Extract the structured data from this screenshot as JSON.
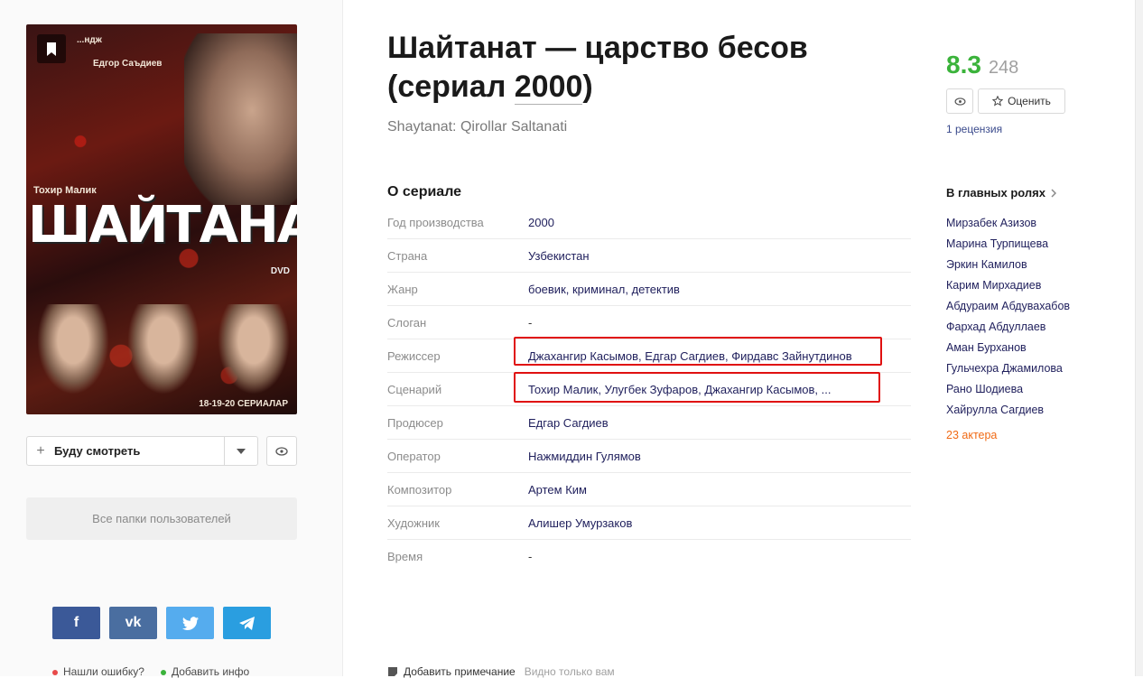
{
  "poster": {
    "top_credit": "...ндж",
    "director_credit": "Едгор Саъдиев",
    "writer_credit": "Тохир Малик",
    "title_text": "ШАЙТАНАТ",
    "dvd_label": "DVD",
    "episodes_credit": "18-19-20 СЕРИАЛАР"
  },
  "watch": {
    "label": "Буду смотреть"
  },
  "folders": {
    "label": "Все папки пользователей"
  },
  "social": [
    {
      "name": "facebook",
      "glyph": "f",
      "color": "#3b5998"
    },
    {
      "name": "vk",
      "glyph": "vk",
      "color": "#4a6ea0"
    },
    {
      "name": "twitter",
      "glyph": "t",
      "color": "#55acee"
    },
    {
      "name": "telegram",
      "glyph": "➤",
      "color": "#2a9ee0"
    }
  ],
  "bottom_links": {
    "error": "Нашли ошибку?",
    "error_color": "#e84a4a",
    "add_info": "Добавить инфо",
    "add_info_color": "#3bb33b"
  },
  "title": {
    "main": "Шайтанат — царство бесов",
    "prefix": "(сериал ",
    "year": "2000",
    "suffix": ")"
  },
  "original_title": "Shaytanat: Qirollar Saltanati",
  "about": {
    "heading": "О сериале",
    "rows": [
      {
        "key": "Год производства",
        "value": "2000"
      },
      {
        "key": "Страна",
        "value": "Узбекистан"
      },
      {
        "key": "Жанр",
        "value": "боевик, криминал, детектив"
      },
      {
        "key": "Слоган",
        "value": "-"
      },
      {
        "key": "Режиссер",
        "value": "Джахангир Касымов, Едгар Сагдиев, Фирдавс Зайнутдинов"
      },
      {
        "key": "Сценарий",
        "value": "Тохир Малик, Улугбек Зуфаров, Джахангир Касымов, ..."
      },
      {
        "key": "Продюсер",
        "value": "Едгар Сагдиев"
      },
      {
        "key": "Оператор",
        "value": "Нажмиддин Гулямов"
      },
      {
        "key": "Композитор",
        "value": "Артем Ким"
      },
      {
        "key": "Художник",
        "value": "Алишер Умурзаков"
      },
      {
        "key": "Время",
        "value": "-"
      }
    ]
  },
  "rating": {
    "score": "8.3",
    "votes": "248",
    "score_color": "#3bb33b"
  },
  "rate_button": "Оценить",
  "reviews": "1 рецензия",
  "cast": {
    "heading": "В главных ролях",
    "actors": [
      "Мирзабек Азизов",
      "Марина Турпищева",
      "Эркин Камилов",
      "Карим Мирхадиев",
      "Абдураим Абдувахабов",
      "Фархад Абдуллаев",
      "Аман Бурханов",
      "Гульчехра Джамилова",
      "Рано Шодиева",
      "Хайрулла Сагдиев"
    ],
    "more": "23 актера"
  },
  "note": {
    "label": "Добавить примечание",
    "hint": "Видно только вам"
  },
  "highlight_color": "#e01010"
}
